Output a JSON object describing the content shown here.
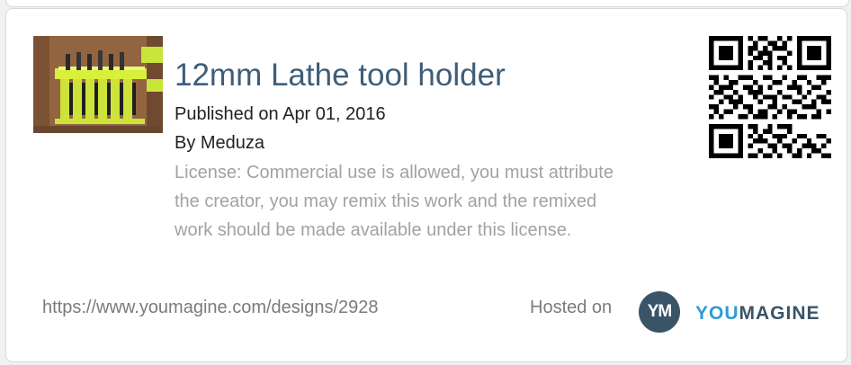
{
  "design": {
    "title": "12mm Lathe tool holder",
    "published": "Published on Apr 01, 2016",
    "author": "By Meduza",
    "license": "License: Commercial use is allowed, you must attribute the creator, you may remix this work and the remixed work should be made available under this license.",
    "url": "https://www.youmagine.com/designs/2928"
  },
  "footer": {
    "hosted_on": "Hosted on",
    "logo_mark": "YM",
    "logo_word_part1": "YOU",
    "logo_word_part2": "MAGINE"
  },
  "colors": {
    "title": "#3f5d78",
    "license_text": "#a2a2a2",
    "logo_dark": "#3a5467",
    "logo_light": "#2e9bd6"
  },
  "icons": {
    "thumbnail": "design-thumbnail-image",
    "qr": "qr-code-icon",
    "logo": "youmagine-logo"
  }
}
